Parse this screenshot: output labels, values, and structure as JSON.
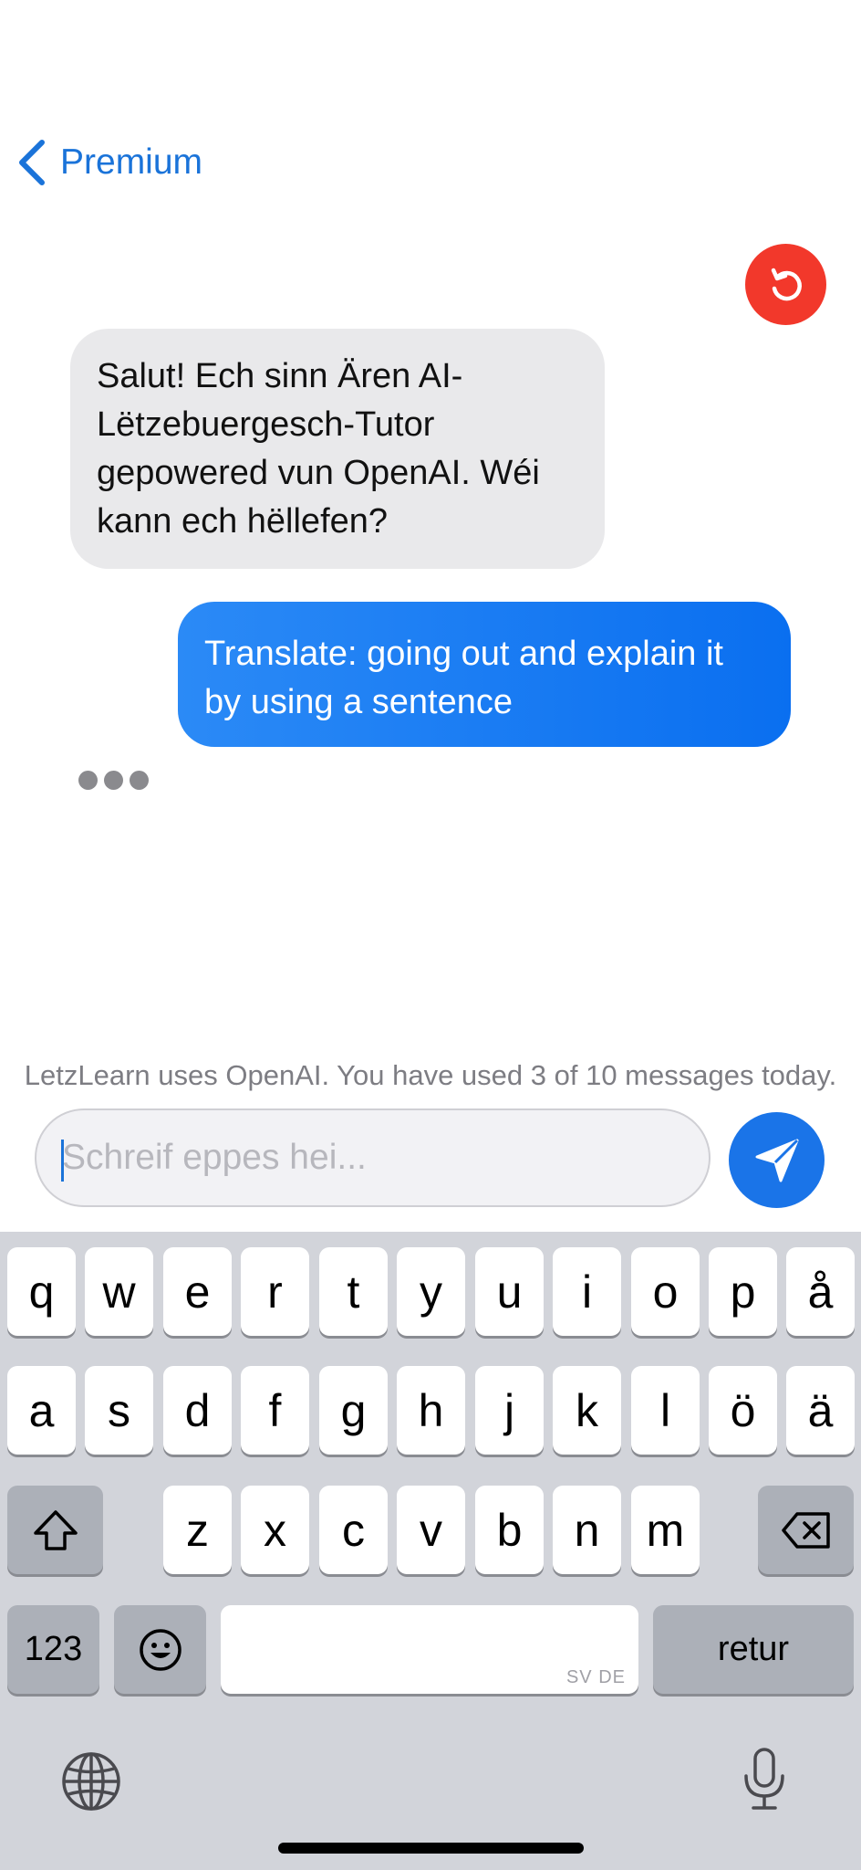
{
  "nav": {
    "back_label": "Premium"
  },
  "chat": {
    "messages": [
      {
        "role": "assistant",
        "text": "Salut! Ech sinn Ären AI-Lëtzebuergesch-Tutor gepowered vun OpenAI. Wéi kann ech hëllefen?"
      },
      {
        "role": "user",
        "text": "Translate: going out and explain it by using a sentence"
      }
    ]
  },
  "usage_note": "LetzLearn uses OpenAI. You have used 3 of 10 messages today.",
  "composer": {
    "placeholder": "Schreif eppes hei...",
    "value": ""
  },
  "keyboard": {
    "row1": [
      "q",
      "w",
      "e",
      "r",
      "t",
      "y",
      "u",
      "i",
      "o",
      "p",
      "å"
    ],
    "row2": [
      "a",
      "s",
      "d",
      "f",
      "g",
      "h",
      "j",
      "k",
      "l",
      "ö",
      "ä"
    ],
    "row3": [
      "z",
      "x",
      "c",
      "v",
      "b",
      "n",
      "m"
    ],
    "numbers_label": "123",
    "space_sublabel": "SV DE",
    "return_label": "retur"
  },
  "colors": {
    "accent": "#1a73d9",
    "refresh_button": "#f2382b",
    "user_bubble": "#1a7cf2",
    "assistant_bubble": "#e9e9eb"
  },
  "icons": [
    "chevron-left-icon",
    "refresh-icon",
    "send-icon",
    "shift-icon",
    "backspace-icon",
    "emoji-icon",
    "globe-icon",
    "microphone-icon"
  ]
}
